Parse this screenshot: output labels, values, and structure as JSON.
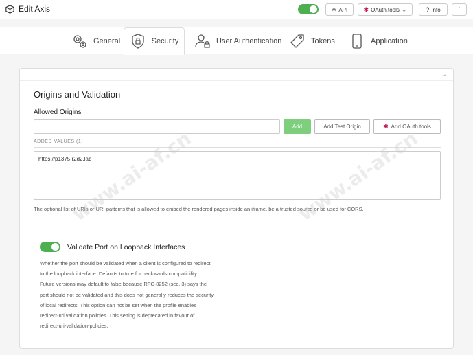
{
  "header": {
    "title": "Edit Axis",
    "enabled": true,
    "api_label": "API",
    "oauth_label": "OAuth.tools",
    "info_label": "Info"
  },
  "tabs": [
    {
      "label": "General",
      "icon": "gears-icon",
      "active": false
    },
    {
      "label": "Security",
      "icon": "shield-lock-icon",
      "active": true
    },
    {
      "label": "User Authentication",
      "icon": "user-lock-icon",
      "active": false
    },
    {
      "label": "Tokens",
      "icon": "tag-icon",
      "active": false
    },
    {
      "label": "Application",
      "icon": "mobile-icon",
      "active": false
    }
  ],
  "origins": {
    "section_title": "Origins and Validation",
    "allowed_label": "Allowed Origins",
    "input_value": "",
    "add_label": "Add",
    "add_test_label": "Add Test Origin",
    "add_oauth_label": "Add OAuth.tools",
    "added_values_label": "ADDED VALUES (1)",
    "values": [
      "https://p1375.r2d2.lab"
    ],
    "help_text": "The optional list of URIs or URI-patterns that is allowed to embed the rendered pages inside an iframe, be a trusted source or be used for CORS."
  },
  "validate_port": {
    "enabled": true,
    "title": "Validate Port on Loopback Interfaces",
    "description_lines": [
      "Whether the port should be validated when a client is configured to redirect",
      "to the loopback interface. Defaults to true for backwards compatibility.",
      "Future versions may default to false because RFC-8252 (sec. 3) says the",
      "port should not be validated and this does not generally reduces the security",
      "of local redirects. This option can not be set when the profile enables",
      "redirect-uri validation policies. This setting is deprecated in favour of",
      "redirect-uri-validation-policies."
    ]
  },
  "colors": {
    "accent_green": "#4caf50",
    "add_button": "#7dce7d",
    "oauth_icon": "#c2185b"
  },
  "watermark": "www.ai-af.cn"
}
